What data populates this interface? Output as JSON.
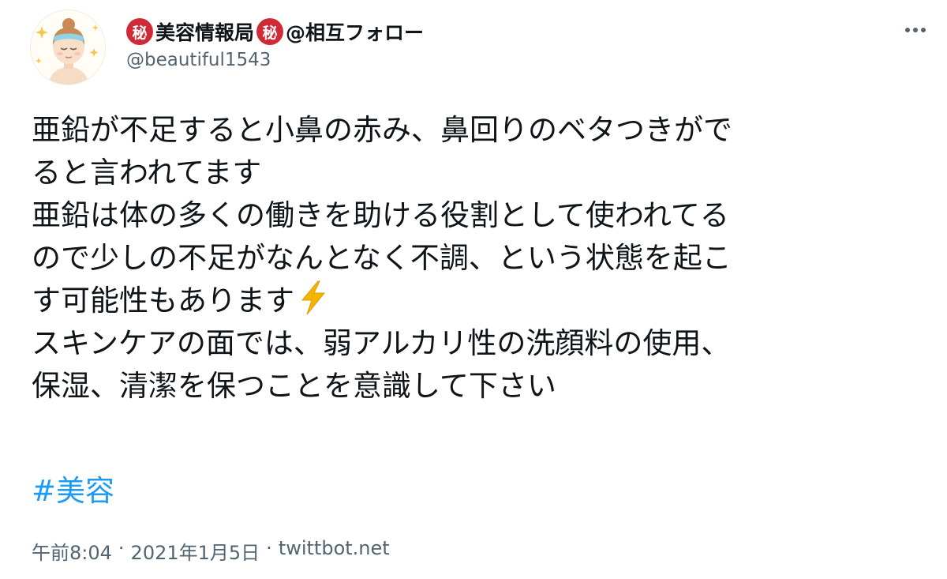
{
  "author": {
    "badge": "秘",
    "name_main": "美容情報局",
    "name_suffix": "@相互フォロー",
    "handle": "@beautiful1543"
  },
  "tweet": {
    "lines": [
      "亜鉛が不足すると小鼻の赤み、鼻回りのベタつきがで",
      "ると言われてます",
      "亜鉛は体の多くの働きを助ける役割として使われてる",
      "ので少しの不足がなんとなく不調、という状態を起こ",
      "す可能性もあります",
      "スキンケアの面では、弱アルカリ性の洗顔料の使用、",
      "保湿、清潔を保つことを意識して下さい"
    ],
    "hashtag": "#美容"
  },
  "meta": {
    "time": "午前8:04",
    "separator": "·",
    "date": "2021年1月5日",
    "source": "twittbot.net"
  },
  "colors": {
    "text": "#0f1419",
    "secondary": "#536471",
    "link": "#1d9bf0",
    "badge": "#cf2a37",
    "bolt": "#f4b400"
  },
  "icons": {
    "avatar": "woman-face-mask-avatar",
    "more": "more-horizontal-icon",
    "bolt": "lightning-bolt-emoji"
  }
}
